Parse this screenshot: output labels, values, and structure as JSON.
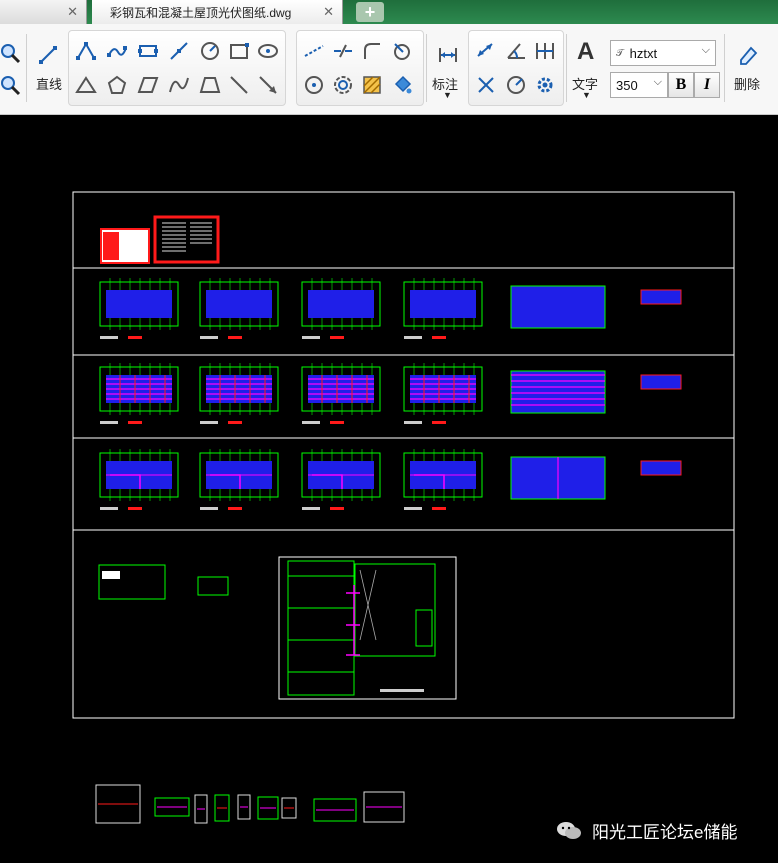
{
  "tabs": [
    {
      "label": "",
      "active": false
    },
    {
      "label": "彩钢瓦和混凝土屋顶光伏图纸.dwg",
      "active": true
    }
  ],
  "add_tab_symbol": "+",
  "ribbon": {
    "draw_group": {
      "line_label": "直线"
    },
    "dimension_group": {
      "label": "标注"
    },
    "text_group": {
      "label": "文字",
      "text_style": "hztxt",
      "text_height": "350",
      "bold_label": "B",
      "italic_label": "I"
    },
    "edit_group": {
      "delete_label": "删除"
    }
  },
  "colors": {
    "tab_green": "#2d8a4f",
    "drawing_blue": "#1f1fe8",
    "drawing_green": "#00ff00",
    "drawing_red": "#ff1a1a",
    "drawing_magenta": "#ff00ff",
    "frame_white": "#ffffff"
  },
  "icons": [
    "zoom-in-icon",
    "zoom-out-icon",
    "line-icon",
    "polyline-icon",
    "circle-icon",
    "rectangle-icon",
    "arc-icon",
    "dimension-icon",
    "text-icon",
    "delete-icon"
  ],
  "watermark": {
    "text": "阳光工匠论坛e储能"
  }
}
